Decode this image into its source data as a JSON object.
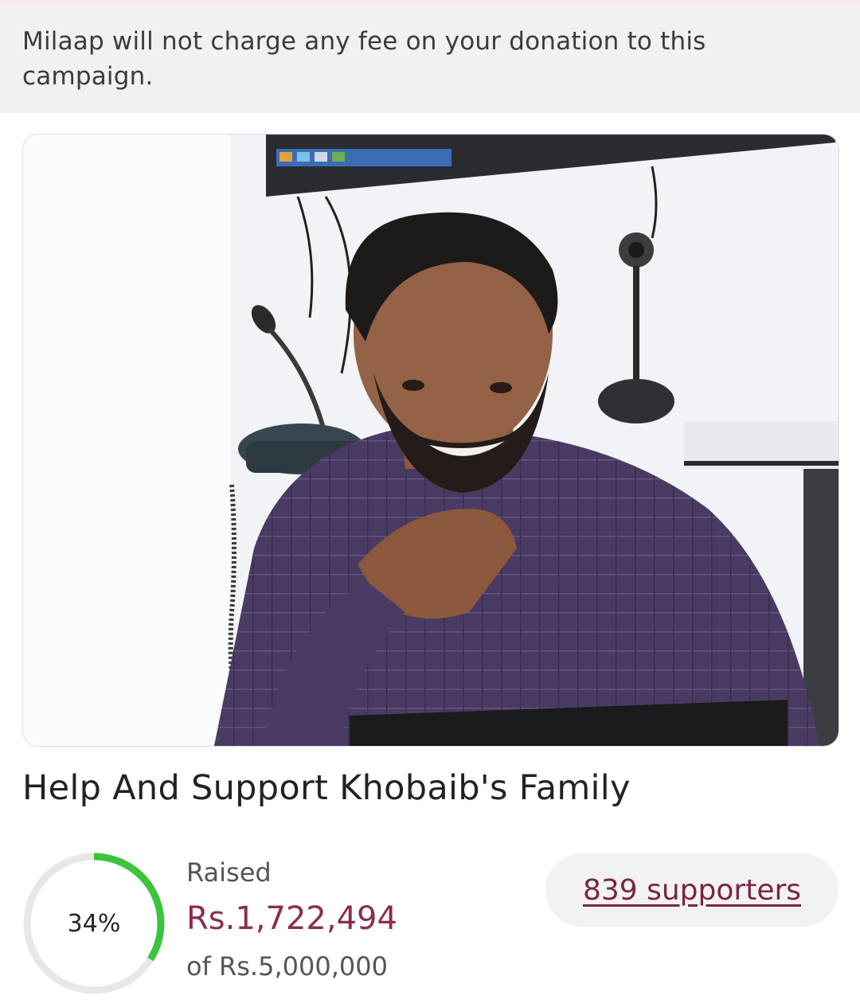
{
  "banner": {
    "text": "Milaap will not charge any fee on your donation to this campaign."
  },
  "campaign": {
    "title": "Help And Support Khobaib's Family",
    "photo_icon": "campaign-photo"
  },
  "progress": {
    "percent_label": "34%",
    "fraction": 0.34,
    "raised_label": "Raised",
    "raised_amount": "Rs.1,722,494",
    "goal_text": "of Rs.5,000,000"
  },
  "supporters": {
    "label": "839 supporters"
  },
  "colors": {
    "accent": "#8a2d4f",
    "progress": "#3cc43c",
    "progress_track": "#e8e6e6",
    "banner_bg": "#f1f1f1"
  }
}
